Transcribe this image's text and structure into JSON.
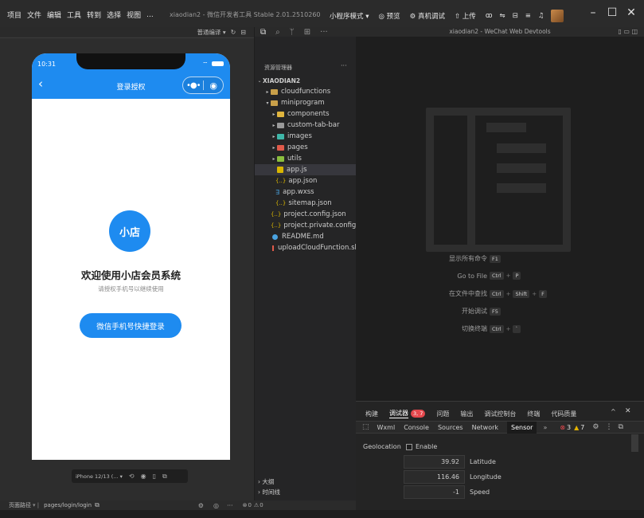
{
  "menu": [
    "项目",
    "文件",
    "编辑",
    "工具",
    "转到",
    "选择",
    "视图",
    "..."
  ],
  "app_title": "xiaodian2 - 微信开发者工具 Stable 2.01.2510260",
  "toolbar": {
    "mode": "小程序模式",
    "preview": "预览",
    "remote_debug": "真机调试",
    "upload": "上传"
  },
  "sim_toolbar": {
    "compile_mode": "普通编译"
  },
  "phone": {
    "time": "10:31",
    "nav_title": "登录授权",
    "avatar_text": "小店",
    "welcome": "欢迎使用小店会员系统",
    "subtitle": "请授权手机号以继续使用",
    "login_button": "微信手机号快捷登录"
  },
  "sim_bottom": {
    "device": "iPhone 12/13 (..."
  },
  "explorer": {
    "header": "资源管理器",
    "root": "XIAODIAN2",
    "items": [
      {
        "label": "cloudfunctions"
      },
      {
        "label": "miniprogram"
      },
      {
        "label": "components"
      },
      {
        "label": "custom-tab-bar"
      },
      {
        "label": "images"
      },
      {
        "label": "pages"
      },
      {
        "label": "utils"
      },
      {
        "label": "app.js"
      },
      {
        "label": "app.json"
      },
      {
        "label": "app.wxss"
      },
      {
        "label": "sitemap.json"
      },
      {
        "label": "project.config.json"
      },
      {
        "label": "project.private.config.js..."
      },
      {
        "label": "README.md"
      },
      {
        "label": "uploadCloudFunction.sh"
      }
    ],
    "outline": "大纲",
    "timeline": "时间线"
  },
  "devtools_window_title": "xiaodian2 - WeChat Web Devtools",
  "shortcuts": [
    {
      "label": "显示所有命令",
      "keys": [
        "F1"
      ]
    },
    {
      "label": "Go to File",
      "keys": [
        "Ctrl",
        "P"
      ]
    },
    {
      "label": "在文件中查找",
      "keys": [
        "Ctrl",
        "Shift",
        "F"
      ]
    },
    {
      "label": "开始调试",
      "keys": [
        "F5"
      ]
    },
    {
      "label": "切换终端",
      "keys": [
        "Ctrl",
        "`"
      ]
    }
  ],
  "panel_tabs": [
    "构建",
    "调试器",
    "问题",
    "输出",
    "调试控制台",
    "终端",
    "代码质量"
  ],
  "debugger_badge": "3, 7",
  "devtools_tabs": [
    "Wxml",
    "Console",
    "Sources",
    "Network",
    "Sensor"
  ],
  "errors": "3",
  "warnings": "7",
  "sensor": {
    "geolocation_label": "Geolocation",
    "enable_label": "Enable",
    "latitude_value": "39.92",
    "latitude_label": "Latitude",
    "longitude_value": "116.46",
    "longitude_label": "Longitude",
    "speed_value": "-1",
    "speed_label": "Speed"
  },
  "status": {
    "page_path_label": "页面路径",
    "page_path": "pages/login/login",
    "problems": "0",
    "warnings": "0"
  },
  "colors": {
    "accent": "#1e8bf0",
    "error": "#e5484d",
    "warn": "#e2b100"
  }
}
